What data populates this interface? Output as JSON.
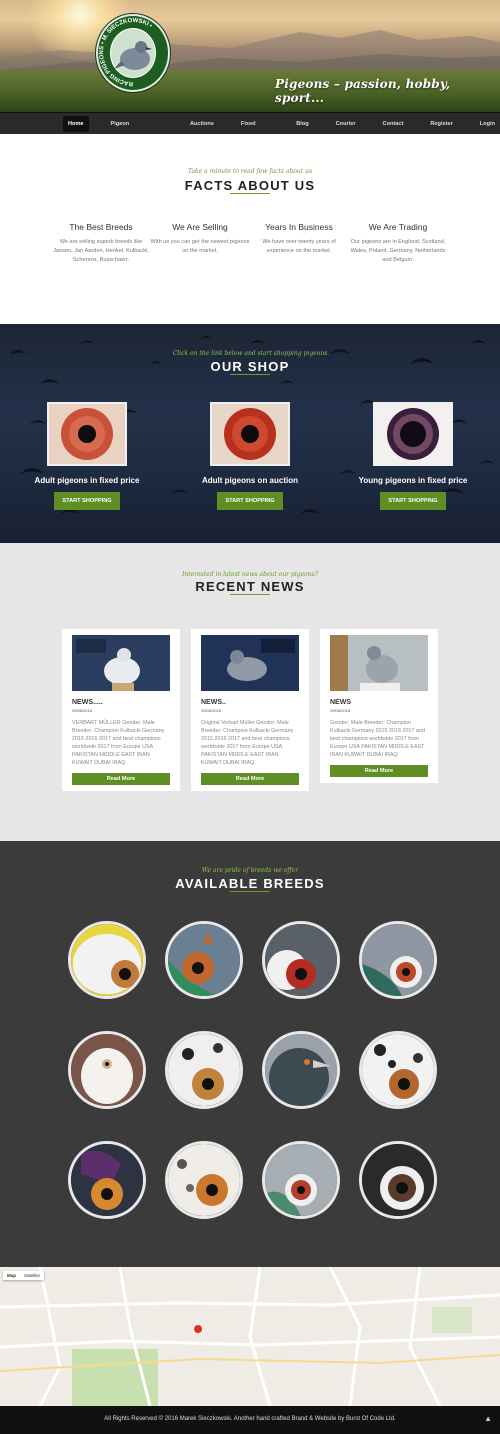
{
  "hero": {
    "logo_text": "RACING PIGEONS • M. SIECZKOWSKI •",
    "tagline": "Pigeons – passion, hobby, sport..."
  },
  "nav": {
    "items": [
      "Home",
      "Pigeon Supplements",
      "Auctions",
      "Fixed Price",
      "Blog",
      "Courier",
      "Contact",
      "Register",
      "Login"
    ],
    "active": "Home"
  },
  "facts": {
    "subtitle": "Take a minute to read few facts about us",
    "title": "FACTS ABOUT US",
    "items": [
      {
        "heading": "The Best Breeds",
        "text": "We are selling superb breeds like Jansen, Jan Aarden, Henkel, Kulbacki, Scherens, Busschaert."
      },
      {
        "heading": "We Are Selling",
        "text": "With us you can get the newest pigeons on the market."
      },
      {
        "heading": "Years In Business",
        "text": "We have over twenty years of experience on the market."
      },
      {
        "heading": "We Are Trading",
        "text": "Our pigeons are in England, Scotland, Wales, Poland, Germany, Netherlands and Belgum."
      }
    ]
  },
  "shop": {
    "subtitle": "Click on the link below and start shopping pigeons",
    "title": "OUR SHOP",
    "items": [
      {
        "heading": "Adult pigeons in fixed price",
        "button": "START SHOPPING"
      },
      {
        "heading": "Adult pigeons on auction",
        "button": "START SHOPPING"
      },
      {
        "heading": "Young pigeons in fixed price",
        "button": "START SHOPPING"
      }
    ]
  },
  "news": {
    "subtitle": "Interested in latest news about our pigeons?",
    "title": "RECENT NEWS",
    "cards": [
      {
        "title": "NEWS.....",
        "date": "29/06/2018",
        "text": "VERBART MÜLLER Gender: Male Breeder: Champion Kulbacki Germany 2015 2016 2017 and best champions worldwide 2017 from Europe USA PAKISTAN MIDDLE EAST IRAN KUWAIT DUBAI IRAQ",
        "button": "Read More"
      },
      {
        "title": "NEWS..",
        "date": "29/06/2018",
        "text": "Original Verbart Müller Gender: Male Breeder: Champion Kulbacki Germany 2015 2016 2017 and best champions worldwide 2017 from Europe USA PAKISTAN MIDDLE EAST IRAN KUWAIT DUBAI IRAQ",
        "button": "Read More"
      },
      {
        "title": "NEWS",
        "date": "29/06/2018",
        "text": "Gender: Male Breeder: Champion Kulbacki Germany 2015 2016 2017 and best champions worldwide 2017 from Europe USA PAKISTAN MIDDLE EAST IRAN KUWAIT DUBAI IRAQ",
        "button": "Read More"
      }
    ]
  },
  "breeds": {
    "subtitle": "We are pride of breeds we offer",
    "title": "AVAILABLE BREEDS"
  },
  "map": {
    "tabs": [
      "Map",
      "Satellite"
    ]
  },
  "footer": {
    "text": "All Rights Reserved © 2016 Marek Sieczkowski. Another hand crafted Brand & Website by Burst Of Code Ltd.",
    "up": "▲"
  },
  "colors": {
    "accent": "#5f8e25",
    "script": "#6a9c2c",
    "nav_bg": "#2a2a2a",
    "breeds_bg": "#3b3b3b"
  }
}
